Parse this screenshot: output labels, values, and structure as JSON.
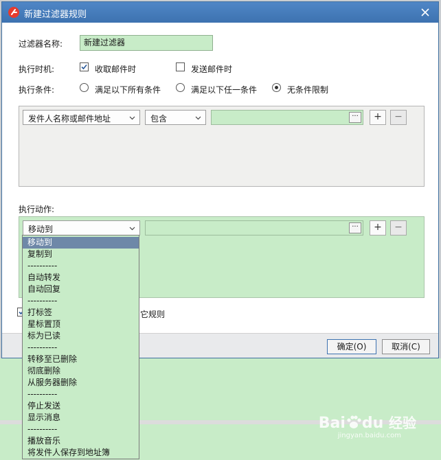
{
  "window": {
    "title": "新建过滤器规则"
  },
  "form": {
    "name_label": "过滤器名称:",
    "name_value": "新建过滤器",
    "timing_label": "执行时机:",
    "timing_receive": "收取邮件时",
    "timing_send": "发送邮件时",
    "cond_label": "执行条件:",
    "cond_all": "满足以下所有条件",
    "cond_any": "满足以下任一条件",
    "cond_none": "无条件限制"
  },
  "condition": {
    "field_select": "发件人名称或邮件地址",
    "op_select": "包含",
    "browse": "···",
    "add": "+",
    "remove": "−"
  },
  "action": {
    "label": "执行动作:",
    "select": "移动到",
    "browse": "···",
    "add": "+",
    "remove": "−"
  },
  "dropdown": {
    "items": [
      "移动到",
      "复制到",
      "----------",
      "自动转发",
      "自动回复",
      "----------",
      "打标签",
      "星标置顶",
      "标为已读",
      "----------",
      "转移至已删除",
      "彻底删除",
      "从服务器删除",
      "----------",
      "停止发送",
      "显示消息",
      "----------",
      "播放音乐",
      "将发件人保存到地址簿"
    ]
  },
  "other_rules_tail": "它规则",
  "buttons": {
    "ok": "确定(O)",
    "cancel": "取消(C)"
  },
  "watermark": {
    "brand": "Bai",
    "brand2": "du",
    "brand_cn": "经验",
    "url": "jingyan.baidu.com"
  },
  "colors": {
    "title_bar": "#4a7fbf",
    "accent_green": "#c8ecc8",
    "selection": "#6e88a8"
  }
}
